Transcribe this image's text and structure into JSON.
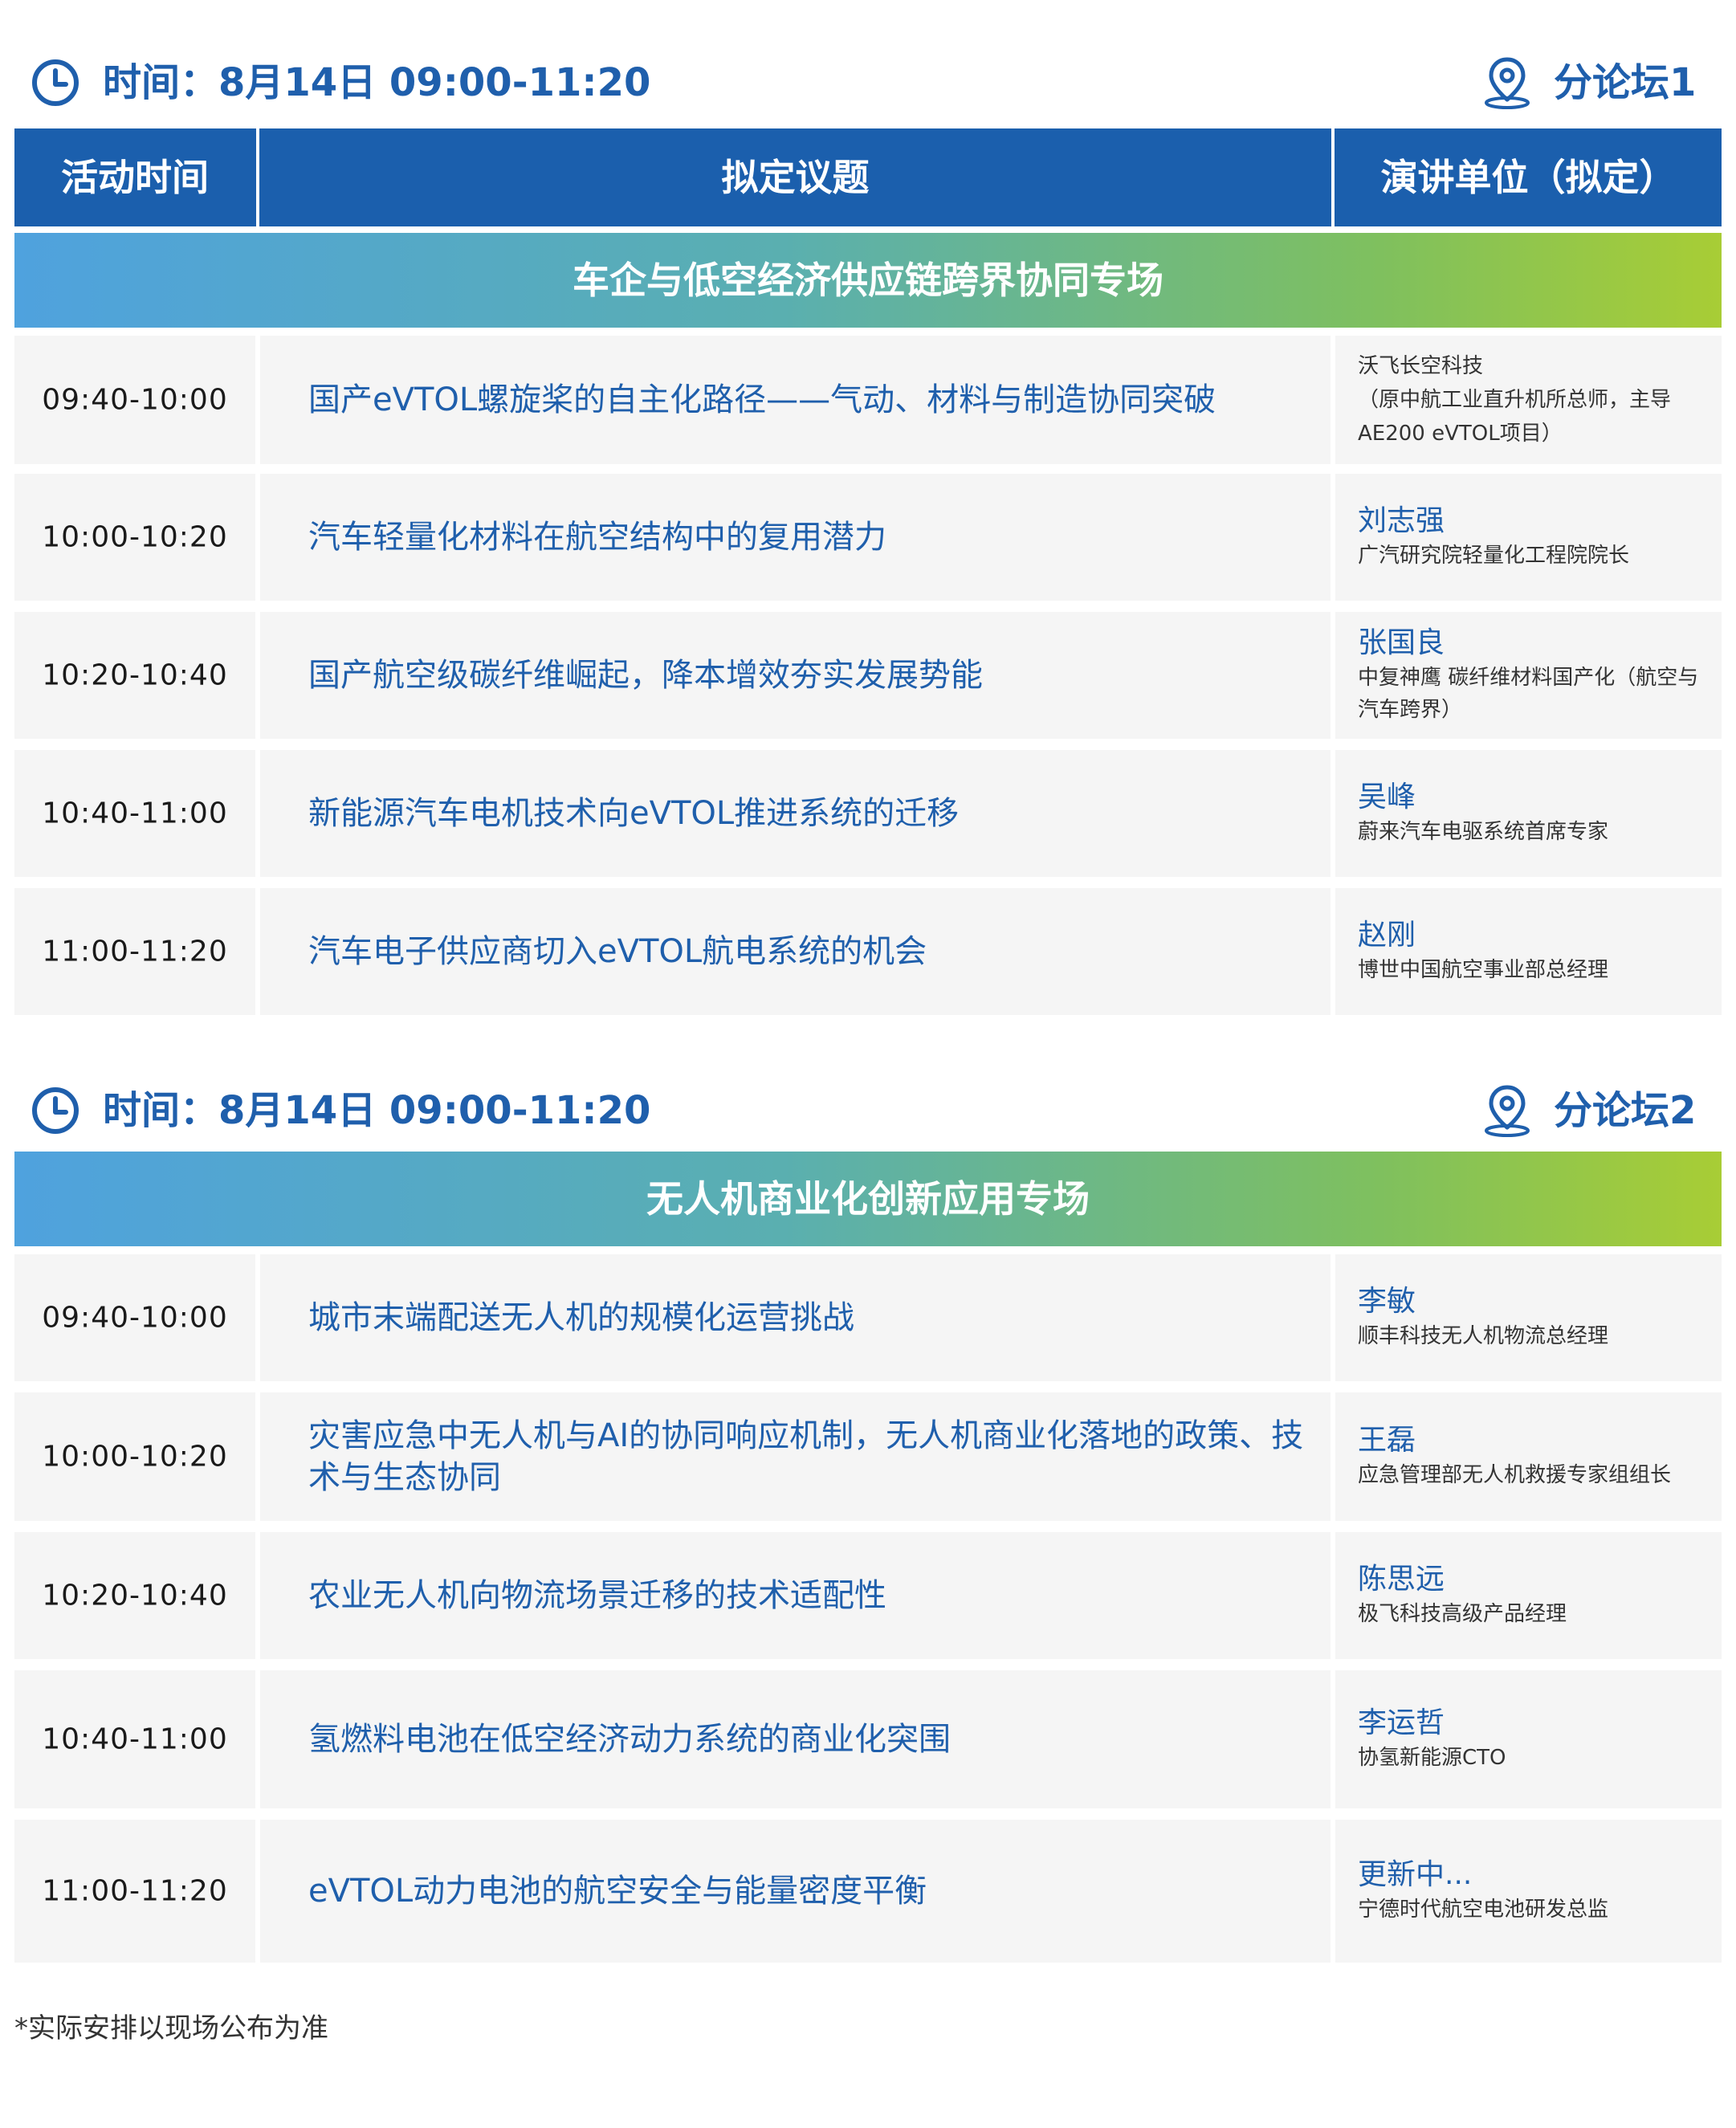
{
  "colors": {
    "primary": "#1b5fad",
    "text_blue": "#1f5fac",
    "gradient_start": "#4fa2de",
    "gradient_end": "#a8cd35",
    "row_bg": "#f5f5f5"
  },
  "icons": {
    "time": "clock-icon",
    "location": "location-pin-icon"
  },
  "table_headers": {
    "time": "活动时间",
    "topic": "拟定议题",
    "speaker": "演讲单位（拟定）"
  },
  "forum1": {
    "time_label": "时间：8月14日 09:00-11:20",
    "forum_label": "分论坛1",
    "banner": "车企与低空经济供应链跨界协同专场",
    "rows": [
      {
        "time": "09:40-10:00",
        "topic": "国产eVTOL螺旋桨的自主化路径——气动、材料与制造协同突破",
        "name": "",
        "title": "沃飞长空科技\n（原中航工业直升机所总师，主导AE200 eVTOL项目）"
      },
      {
        "time": "10:00-10:20",
        "topic": "汽车轻量化材料在航空结构中的复用潜力",
        "name": "刘志强",
        "title": "广汽研究院轻量化工程院院长"
      },
      {
        "time": "10:20-10:40",
        "topic": "国产航空级碳纤维崛起，降本增效夯实发展势能",
        "name": "张国良",
        "title": "中复神鹰 碳纤维材料国产化（航空与汽车跨界）"
      },
      {
        "time": "10:40-11:00",
        "topic": "新能源汽车电机技术向eVTOL推进系统的迁移",
        "name": "吴峰",
        "title": "蔚来汽车电驱系统首席专家"
      },
      {
        "time": "11:00-11:20",
        "topic": "汽车电子供应商切入eVTOL航电系统的机会",
        "name": "赵刚",
        "title": "博世中国航空事业部总经理"
      }
    ]
  },
  "forum2": {
    "time_label": "时间：8月14日 09:00-11:20",
    "forum_label": "分论坛2",
    "banner": "无人机商业化创新应用专场",
    "rows": [
      {
        "time": "09:40-10:00",
        "topic": "城市末端配送无人机的规模化运营挑战",
        "name": "李敏",
        "title": "顺丰科技无人机物流总经理"
      },
      {
        "time": "10:00-10:20",
        "topic": "灾害应急中无人机与AI的协同响应机制，无人机商业化落地的政策、技术与生态协同",
        "name": "王磊",
        "title": "应急管理部无人机救援专家组组长"
      },
      {
        "time": "10:20-10:40",
        "topic": "农业无人机向物流场景迁移的技术适配性",
        "name": "陈思远",
        "title": "极飞科技高级产品经理"
      },
      {
        "time": "10:40-11:00",
        "topic": "氢燃料电池在低空经济动力系统的商业化突围",
        "name": "李运哲",
        "title": "协氢新能源CTO"
      },
      {
        "time": "11:00-11:20",
        "topic": "eVTOL动力电池的航空安全与能量密度平衡",
        "name": "更新中...",
        "title": "宁德时代航空电池研发总监"
      }
    ]
  },
  "footnote": "*实际安排以现场公布为准"
}
